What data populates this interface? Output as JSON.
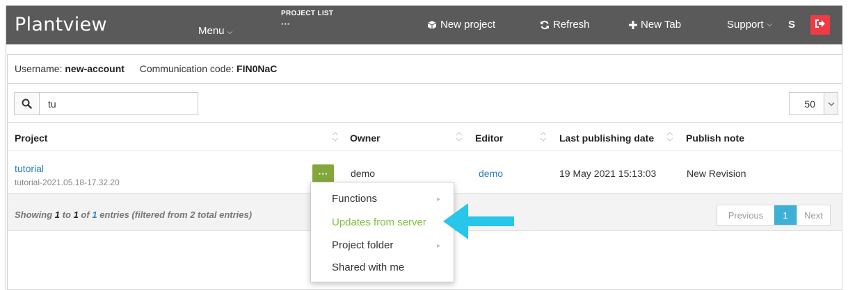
{
  "app": {
    "brand": "Plantview",
    "menu_label": "Menu",
    "project_list_title": "PROJECT LIST",
    "project_list_value": "···",
    "new_project": "New project",
    "refresh": "Refresh",
    "new_tab": "New Tab",
    "support": "Support",
    "user_initial": "S"
  },
  "account": {
    "username_label": "Username:",
    "username": "new-account",
    "code_label": "Communication code:",
    "code": "FIN0NaC"
  },
  "search": {
    "value": "tu"
  },
  "page_size": "50",
  "table": {
    "headers": {
      "project": "Project",
      "owner": "Owner",
      "editor": "Editor",
      "last_publishing": "Last publishing date",
      "publish_note": "Publish note"
    },
    "rows": [
      {
        "name": "tutorial",
        "sub": "tutorial-2021.05.18-17.32.20",
        "actions": "···",
        "owner": "demo",
        "editor": "demo",
        "date": "19 May 2021 15:13:03",
        "note": "New Revision"
      }
    ]
  },
  "footer": {
    "showing": "Showing",
    "start": "1",
    "to": "to",
    "end": "1",
    "of": "of",
    "total": "1",
    "rest": "entries (filtered from 2 total entries)"
  },
  "pagination": {
    "previous": "Previous",
    "current": "1",
    "next": "Next"
  },
  "dropdown": {
    "items": [
      {
        "label": "Functions",
        "submenu": "▸"
      },
      {
        "label": "Updates from server"
      },
      {
        "label": "Project folder",
        "submenu": "▸"
      },
      {
        "label": "Shared with me"
      }
    ]
  },
  "colors": {
    "navbar": "#5a5a5a",
    "logout": "#ef3b44",
    "action_button": "#82a83b",
    "link": "#2a7fc1",
    "active_page": "#3fb0d5",
    "highlight_item": "#7fbf3a",
    "callout_arrow": "#27c6ea"
  },
  "icons": [
    "cube-icon",
    "refresh-icon",
    "plus-icon",
    "logout-icon",
    "search-icon",
    "chevron-down-icon",
    "sort-icon",
    "callout-arrow"
  ]
}
